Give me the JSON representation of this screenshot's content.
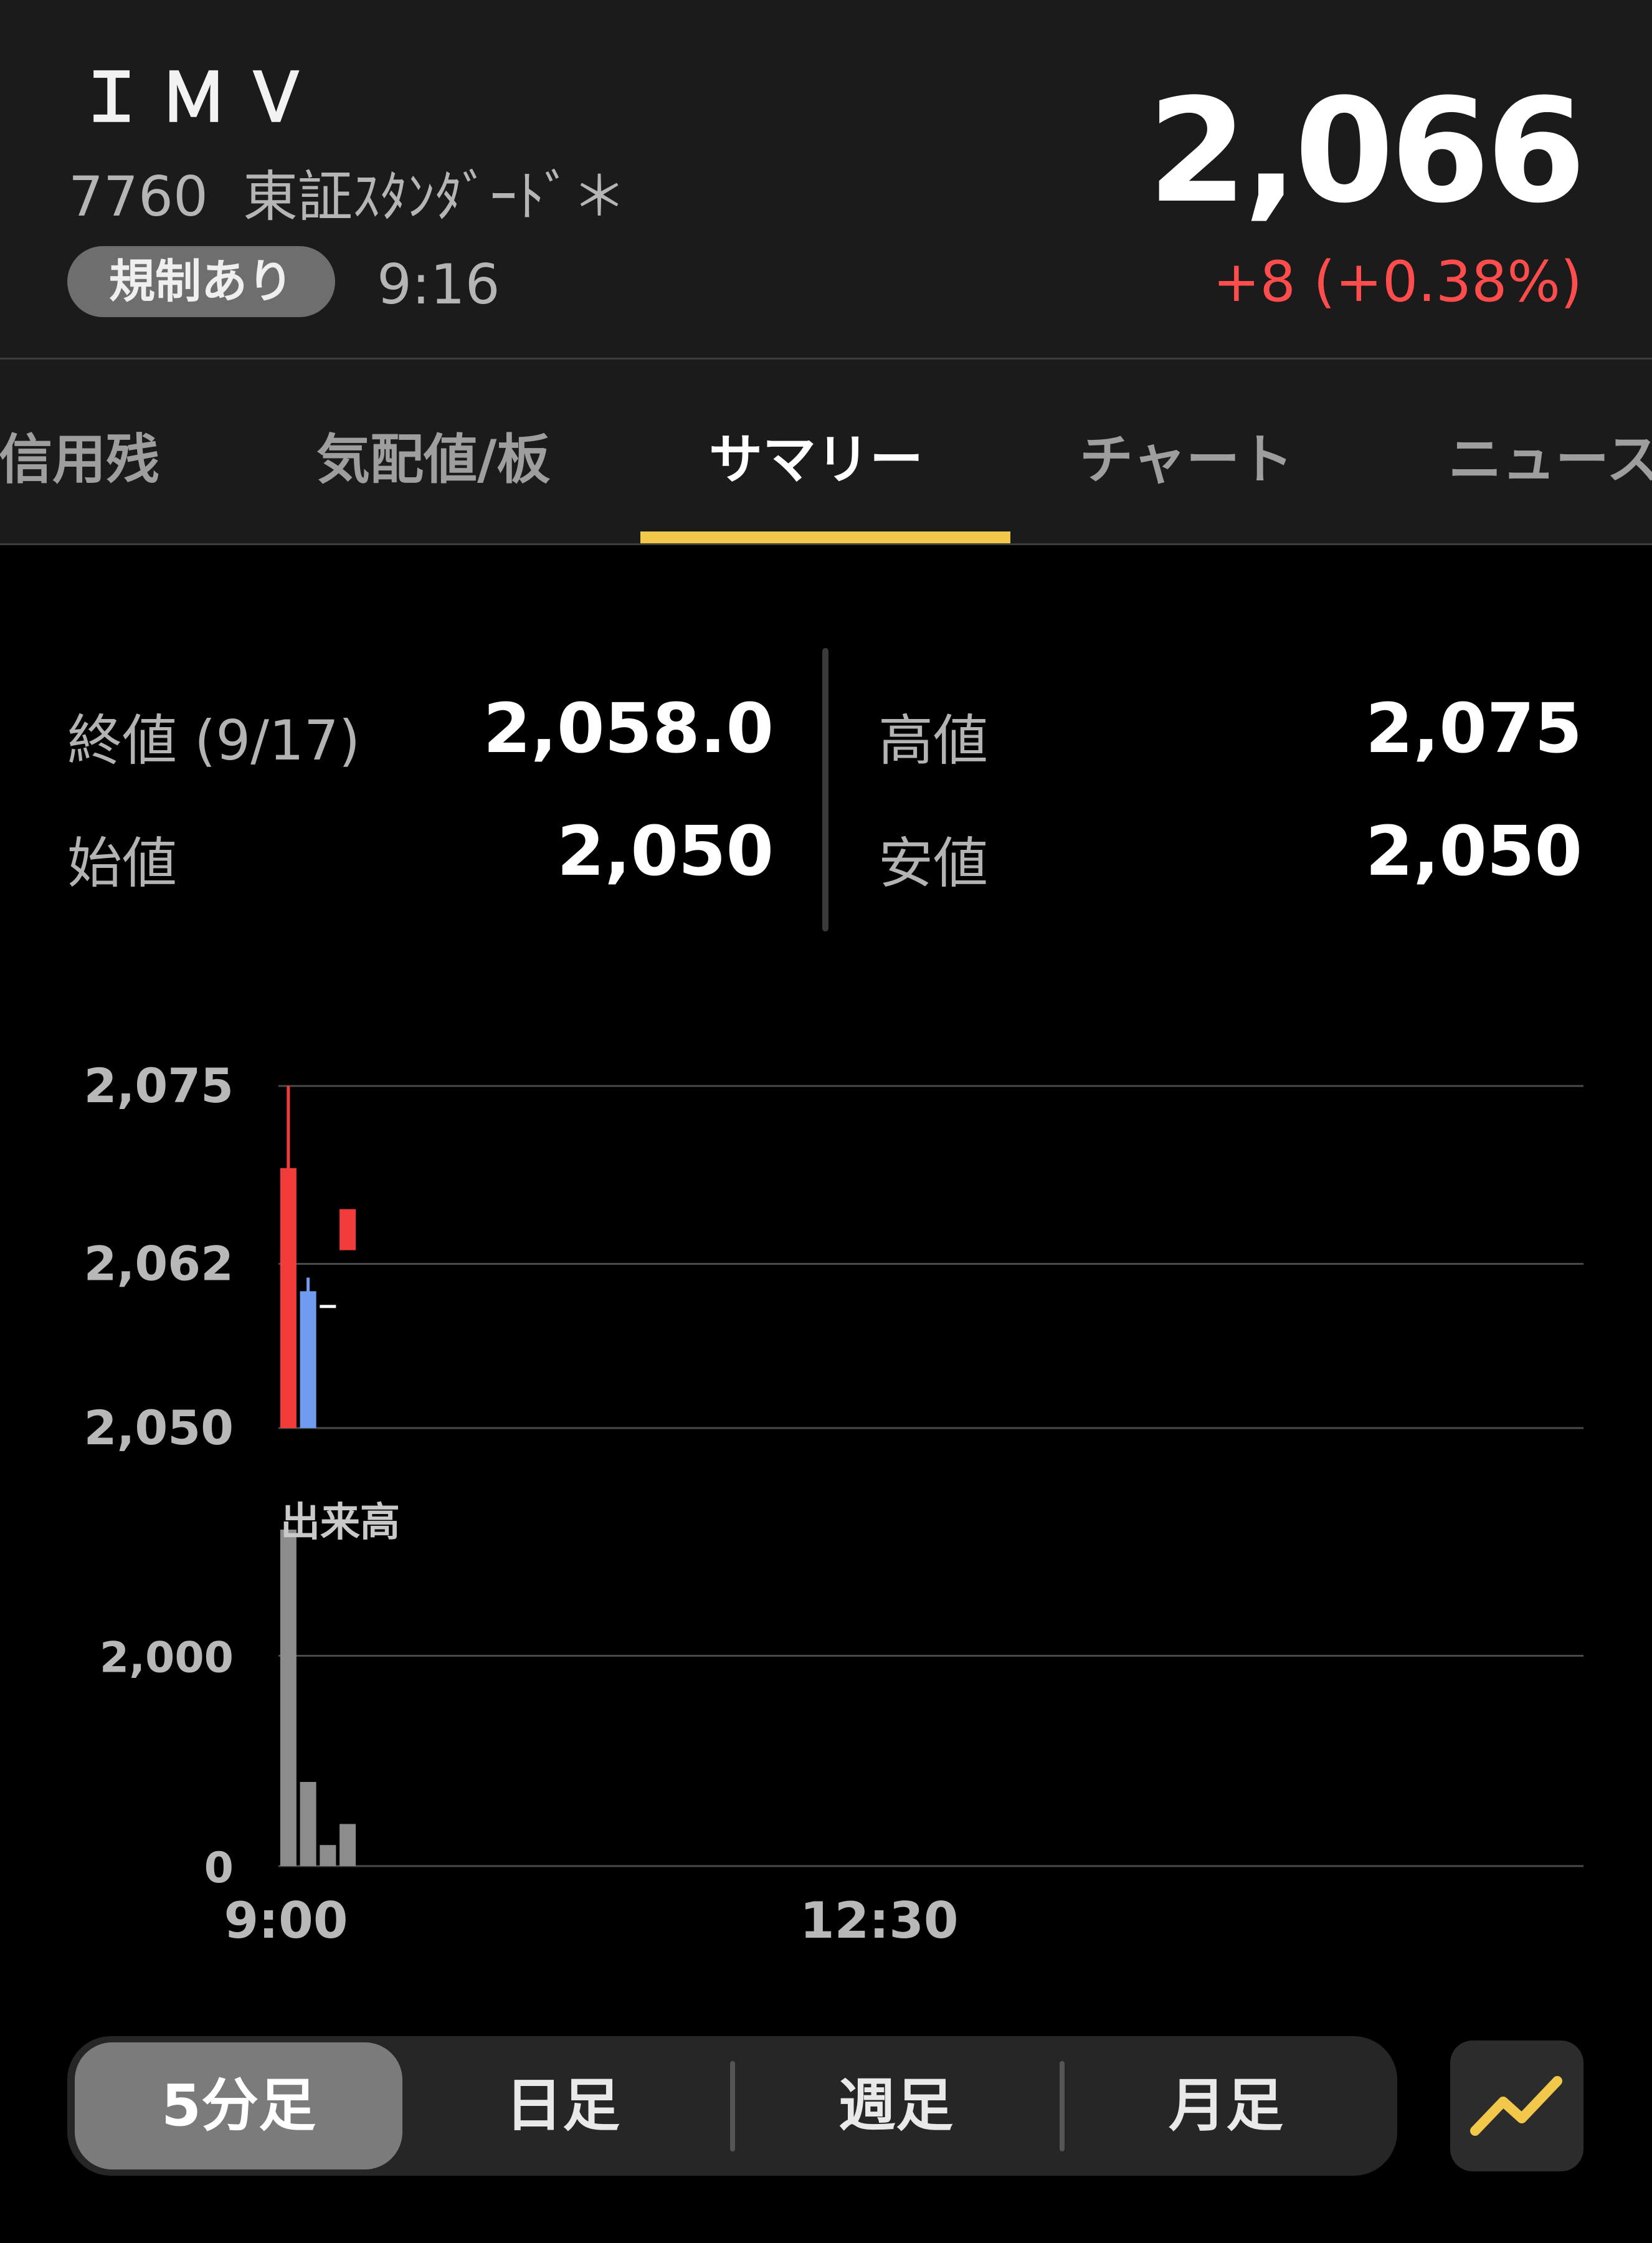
{
  "header": {
    "ticker": "ＩＭＶ",
    "code": "7760",
    "market": "東証ｽﾀﾝﾀﾞｰﾄﾞ＊",
    "badge": "規制あり",
    "time": "9:16",
    "price": "2,066",
    "change": "+8 (+0.38%)",
    "change_color": "#ff4d4d"
  },
  "tabs": [
    {
      "label": "信用残",
      "active": false
    },
    {
      "label": "気配値/板",
      "active": false
    },
    {
      "label": "サマリー",
      "active": true
    },
    {
      "label": "チャート",
      "active": false
    },
    {
      "label": "ニュース",
      "active": false
    }
  ],
  "summary": {
    "close_label": "終値 (9/17)",
    "close_value": "2,058.0",
    "open_label": "始値",
    "open_value": "2,050",
    "high_label": "高値",
    "high_value": "2,075",
    "low_label": "安値",
    "low_value": "2,050"
  },
  "chart_data": {
    "type": "candlestick",
    "price_axis": {
      "ticks": [
        "2,075",
        "2,062",
        "2,050"
      ],
      "ylim": [
        2050,
        2075
      ]
    },
    "volume_axis": {
      "label": "出来高",
      "ticks": [
        "2,000",
        "0"
      ],
      "ylim": [
        0,
        3200
      ]
    },
    "x_ticks": [
      "9:00",
      "12:30"
    ],
    "x_range": [
      "9:00",
      "15:30"
    ],
    "candles": [
      {
        "time": "9:00",
        "open": 2050,
        "close": 2069,
        "high": 2075,
        "low": 2050
      },
      {
        "time": "9:05",
        "open": 2060,
        "close": 2050,
        "high": 2061,
        "low": 2050
      },
      {
        "time": "9:10",
        "open": 2059,
        "close": 2059,
        "high": 2059,
        "low": 2059
      },
      {
        "time": "9:15",
        "open": 2063,
        "close": 2066,
        "high": 2066,
        "low": 2063
      }
    ],
    "volumes": [
      3200,
      800,
      200,
      400
    ],
    "colors": {
      "up": "#f23b3b",
      "down": "#6f9cf0",
      "flat": "#ffffff",
      "volume": "#8c8c8c",
      "grid": "#4a4a4a"
    }
  },
  "timeframes": [
    {
      "label": "5分足",
      "active": true
    },
    {
      "label": "日足",
      "active": false
    },
    {
      "label": "週足",
      "active": false
    },
    {
      "label": "月足",
      "active": false
    }
  ],
  "chart_toggle_icon": "line-chart-icon",
  "accent_color": "#f2c84b"
}
